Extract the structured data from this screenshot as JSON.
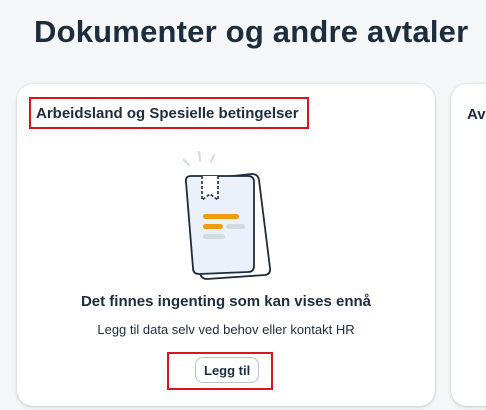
{
  "page": {
    "title": "Dokumenter og andre avtaler"
  },
  "cards": [
    {
      "title": "Arbeidsland og Spesielle betingelser",
      "empty_title": "Det finnes ingenting som kan vises ennå",
      "empty_subtitle": "Legg til data selv ved behov eller kontakt HR",
      "add_button_label": "Legg til",
      "illustration_icon": "empty-document-illustration-icon"
    },
    {
      "title": "Av"
    }
  ],
  "colors": {
    "highlight_frame": "#d9161e",
    "illustration_stroke": "#1d2d3e",
    "illustration_orange": "#f39a0e",
    "illustration_grey": "#d5dadd",
    "illustration_paper": "#e8f0fb"
  }
}
